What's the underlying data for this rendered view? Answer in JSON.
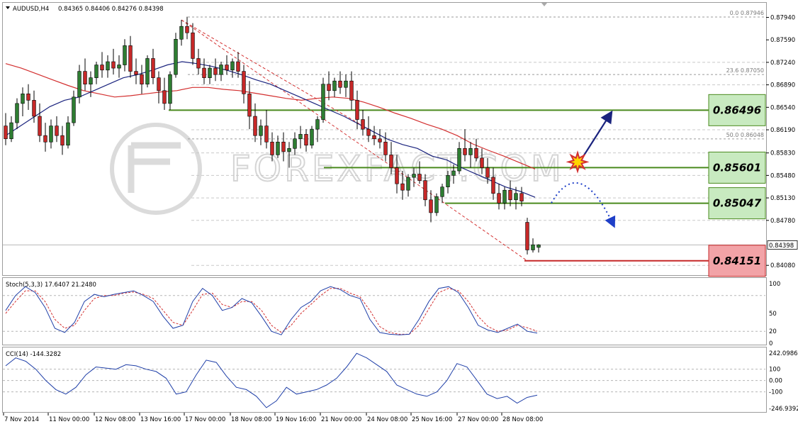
{
  "header": {
    "symbol": "AUDUSD,H4",
    "ohlc": "0.84365 0.84406 0.84276 0.84398"
  },
  "indicators": {
    "stoch_label": "Stoch(5,3,3) 17.6407 21.2480",
    "cci_label": "CCI(14) -144.3282"
  },
  "price_axis": {
    "ticks": [
      "0.87940",
      "0.87590",
      "0.87240",
      "0.86890",
      "0.86540",
      "0.86190",
      "0.85830",
      "0.85480",
      "0.85130",
      "0.84780",
      "0.84080"
    ],
    "current_price": "0.84398"
  },
  "stoch_axis": {
    "ticks": [
      "100",
      "50",
      "20",
      "0"
    ]
  },
  "cci_axis": {
    "ticks": [
      "242.0986",
      "100",
      "0.00",
      "-100",
      "-246.9392"
    ]
  },
  "time_axis": {
    "labels": [
      "7 Nov 2014",
      "11 Nov 00:00",
      "12 Nov 08:00",
      "13 Nov 16:00",
      "17 Nov 00:00",
      "18 Nov 08:00",
      "19 Nov 16:00",
      "21 Nov 00:00",
      "24 Nov 08:00",
      "25 Nov 16:00",
      "27 Nov 00:00",
      "28 Nov 08:00"
    ]
  },
  "fibonacci": {
    "levels": [
      {
        "label": "0.0  0.87946"
      },
      {
        "label": "23.6  0.87050"
      },
      {
        "label": "50.0  0.86048"
      }
    ]
  },
  "levels": [
    {
      "value": "0.86496",
      "color": "#c8eac0"
    },
    {
      "value": "0.85601",
      "color": "#c8eac0"
    },
    {
      "value": "0.85047",
      "color": "#c8eac0"
    },
    {
      "value": "0.84151",
      "color": "#f2a3a7"
    }
  ],
  "watermark": "FOREXFACT.COM",
  "colors": {
    "bull": "#2e7d32",
    "bear": "#c62828",
    "ma_fast": "#1a237e",
    "ma_slow": "#d32f2f",
    "support_line": "#4a8a1e",
    "red_line": "#c62828",
    "stoch": "#1f3fa8",
    "cci": "#1f3fa8"
  },
  "chart_data": {
    "type": "candlestick",
    "symbol": "AUDUSD",
    "timeframe": "H4",
    "ylim": [
      0.8395,
      0.881
    ],
    "highlighted_levels": [
      0.86496,
      0.85601,
      0.85047,
      0.84151
    ],
    "fibonacci": [
      {
        "ratio": 0.0,
        "price": 0.87946
      },
      {
        "ratio": 23.6,
        "price": 0.8705
      },
      {
        "ratio": 50.0,
        "price": 0.86048
      }
    ],
    "candles": [
      {
        "o": 0.8625,
        "h": 0.8645,
        "l": 0.8595,
        "c": 0.8605
      },
      {
        "o": 0.8605,
        "h": 0.864,
        "l": 0.86,
        "c": 0.863
      },
      {
        "o": 0.863,
        "h": 0.8668,
        "l": 0.862,
        "c": 0.866
      },
      {
        "o": 0.866,
        "h": 0.8685,
        "l": 0.864,
        "c": 0.8675
      },
      {
        "o": 0.8675,
        "h": 0.869,
        "l": 0.865,
        "c": 0.8665
      },
      {
        "o": 0.8665,
        "h": 0.868,
        "l": 0.863,
        "c": 0.864
      },
      {
        "o": 0.864,
        "h": 0.866,
        "l": 0.86,
        "c": 0.861
      },
      {
        "o": 0.861,
        "h": 0.863,
        "l": 0.8585,
        "c": 0.86
      },
      {
        "o": 0.86,
        "h": 0.8635,
        "l": 0.859,
        "c": 0.8625
      },
      {
        "o": 0.8625,
        "h": 0.864,
        "l": 0.86,
        "c": 0.861
      },
      {
        "o": 0.861,
        "h": 0.8625,
        "l": 0.858,
        "c": 0.8595
      },
      {
        "o": 0.8595,
        "h": 0.864,
        "l": 0.859,
        "c": 0.863
      },
      {
        "o": 0.863,
        "h": 0.868,
        "l": 0.8625,
        "c": 0.867
      },
      {
        "o": 0.867,
        "h": 0.872,
        "l": 0.866,
        "c": 0.871
      },
      {
        "o": 0.871,
        "h": 0.873,
        "l": 0.868,
        "c": 0.869
      },
      {
        "o": 0.869,
        "h": 0.871,
        "l": 0.867,
        "c": 0.87
      },
      {
        "o": 0.87,
        "h": 0.8725,
        "l": 0.869,
        "c": 0.872
      },
      {
        "o": 0.872,
        "h": 0.874,
        "l": 0.87,
        "c": 0.8712
      },
      {
        "o": 0.8712,
        "h": 0.8735,
        "l": 0.87,
        "c": 0.8725
      },
      {
        "o": 0.8725,
        "h": 0.8745,
        "l": 0.8705,
        "c": 0.8715
      },
      {
        "o": 0.8715,
        "h": 0.8735,
        "l": 0.87,
        "c": 0.872
      },
      {
        "o": 0.872,
        "h": 0.876,
        "l": 0.871,
        "c": 0.875
      },
      {
        "o": 0.875,
        "h": 0.8765,
        "l": 0.87,
        "c": 0.871
      },
      {
        "o": 0.871,
        "h": 0.873,
        "l": 0.869,
        "c": 0.8705
      },
      {
        "o": 0.8705,
        "h": 0.872,
        "l": 0.8675,
        "c": 0.869
      },
      {
        "o": 0.869,
        "h": 0.8735,
        "l": 0.8685,
        "c": 0.873
      },
      {
        "o": 0.873,
        "h": 0.8745,
        "l": 0.869,
        "c": 0.87
      },
      {
        "o": 0.87,
        "h": 0.871,
        "l": 0.866,
        "c": 0.868
      },
      {
        "o": 0.868,
        "h": 0.87,
        "l": 0.865,
        "c": 0.866
      },
      {
        "o": 0.866,
        "h": 0.871,
        "l": 0.865,
        "c": 0.8705
      },
      {
        "o": 0.8705,
        "h": 0.877,
        "l": 0.87,
        "c": 0.876
      },
      {
        "o": 0.876,
        "h": 0.879,
        "l": 0.875,
        "c": 0.878
      },
      {
        "o": 0.878,
        "h": 0.8795,
        "l": 0.876,
        "c": 0.877
      },
      {
        "o": 0.877,
        "h": 0.8785,
        "l": 0.872,
        "c": 0.873
      },
      {
        "o": 0.873,
        "h": 0.8745,
        "l": 0.8705,
        "c": 0.8715
      },
      {
        "o": 0.8715,
        "h": 0.873,
        "l": 0.869,
        "c": 0.87
      },
      {
        "o": 0.87,
        "h": 0.872,
        "l": 0.869,
        "c": 0.8715
      },
      {
        "o": 0.8715,
        "h": 0.873,
        "l": 0.8695,
        "c": 0.8705
      },
      {
        "o": 0.8705,
        "h": 0.8725,
        "l": 0.8695,
        "c": 0.872
      },
      {
        "o": 0.872,
        "h": 0.8735,
        "l": 0.8705,
        "c": 0.8712
      },
      {
        "o": 0.8712,
        "h": 0.873,
        "l": 0.87,
        "c": 0.8725
      },
      {
        "o": 0.8725,
        "h": 0.874,
        "l": 0.87,
        "c": 0.871
      },
      {
        "o": 0.871,
        "h": 0.872,
        "l": 0.866,
        "c": 0.8675
      },
      {
        "o": 0.8675,
        "h": 0.8695,
        "l": 0.862,
        "c": 0.864
      },
      {
        "o": 0.864,
        "h": 0.866,
        "l": 0.86,
        "c": 0.861
      },
      {
        "o": 0.861,
        "h": 0.8635,
        "l": 0.8595,
        "c": 0.8625
      },
      {
        "o": 0.8625,
        "h": 0.865,
        "l": 0.859,
        "c": 0.86
      },
      {
        "o": 0.86,
        "h": 0.8615,
        "l": 0.857,
        "c": 0.858
      },
      {
        "o": 0.858,
        "h": 0.861,
        "l": 0.8575,
        "c": 0.86
      },
      {
        "o": 0.86,
        "h": 0.8615,
        "l": 0.857,
        "c": 0.8585
      },
      {
        "o": 0.8585,
        "h": 0.86,
        "l": 0.856,
        "c": 0.859
      },
      {
        "o": 0.859,
        "h": 0.8615,
        "l": 0.858,
        "c": 0.8605
      },
      {
        "o": 0.8605,
        "h": 0.8625,
        "l": 0.859,
        "c": 0.8612
      },
      {
        "o": 0.8612,
        "h": 0.862,
        "l": 0.8585,
        "c": 0.8595
      },
      {
        "o": 0.8595,
        "h": 0.8625,
        "l": 0.859,
        "c": 0.862
      },
      {
        "o": 0.862,
        "h": 0.864,
        "l": 0.86,
        "c": 0.8635
      },
      {
        "o": 0.8635,
        "h": 0.87,
        "l": 0.863,
        "c": 0.869
      },
      {
        "o": 0.869,
        "h": 0.871,
        "l": 0.8665,
        "c": 0.868
      },
      {
        "o": 0.868,
        "h": 0.87,
        "l": 0.867,
        "c": 0.8695
      },
      {
        "o": 0.8695,
        "h": 0.871,
        "l": 0.8675,
        "c": 0.8685
      },
      {
        "o": 0.8685,
        "h": 0.8705,
        "l": 0.867,
        "c": 0.8695
      },
      {
        "o": 0.8695,
        "h": 0.871,
        "l": 0.865,
        "c": 0.8665
      },
      {
        "o": 0.8665,
        "h": 0.868,
        "l": 0.862,
        "c": 0.8635
      },
      {
        "o": 0.8635,
        "h": 0.865,
        "l": 0.861,
        "c": 0.862
      },
      {
        "o": 0.862,
        "h": 0.864,
        "l": 0.86,
        "c": 0.861
      },
      {
        "o": 0.861,
        "h": 0.8625,
        "l": 0.8595,
        "c": 0.8605
      },
      {
        "o": 0.8605,
        "h": 0.862,
        "l": 0.859,
        "c": 0.86
      },
      {
        "o": 0.86,
        "h": 0.8615,
        "l": 0.857,
        "c": 0.858
      },
      {
        "o": 0.858,
        "h": 0.86,
        "l": 0.855,
        "c": 0.856
      },
      {
        "o": 0.856,
        "h": 0.858,
        "l": 0.852,
        "c": 0.8535
      },
      {
        "o": 0.8535,
        "h": 0.8555,
        "l": 0.851,
        "c": 0.8525
      },
      {
        "o": 0.8525,
        "h": 0.855,
        "l": 0.8515,
        "c": 0.8545
      },
      {
        "o": 0.8545,
        "h": 0.856,
        "l": 0.853,
        "c": 0.855
      },
      {
        "o": 0.855,
        "h": 0.857,
        "l": 0.8535,
        "c": 0.854
      },
      {
        "o": 0.854,
        "h": 0.855,
        "l": 0.85,
        "c": 0.851
      },
      {
        "o": 0.851,
        "h": 0.8525,
        "l": 0.8475,
        "c": 0.849
      },
      {
        "o": 0.849,
        "h": 0.852,
        "l": 0.8485,
        "c": 0.8515
      },
      {
        "o": 0.8515,
        "h": 0.8535,
        "l": 0.8505,
        "c": 0.853
      },
      {
        "o": 0.853,
        "h": 0.8555,
        "l": 0.852,
        "c": 0.8548
      },
      {
        "o": 0.8548,
        "h": 0.8565,
        "l": 0.8535,
        "c": 0.8555
      },
      {
        "o": 0.8555,
        "h": 0.86,
        "l": 0.855,
        "c": 0.859
      },
      {
        "o": 0.859,
        "h": 0.862,
        "l": 0.857,
        "c": 0.858
      },
      {
        "o": 0.858,
        "h": 0.86,
        "l": 0.856,
        "c": 0.859
      },
      {
        "o": 0.859,
        "h": 0.8605,
        "l": 0.857,
        "c": 0.8575
      },
      {
        "o": 0.8575,
        "h": 0.859,
        "l": 0.855,
        "c": 0.856
      },
      {
        "o": 0.856,
        "h": 0.8575,
        "l": 0.8535,
        "c": 0.8545
      },
      {
        "o": 0.8545,
        "h": 0.856,
        "l": 0.851,
        "c": 0.852
      },
      {
        "o": 0.852,
        "h": 0.8535,
        "l": 0.8495,
        "c": 0.8505
      },
      {
        "o": 0.8505,
        "h": 0.853,
        "l": 0.8495,
        "c": 0.8525
      },
      {
        "o": 0.8525,
        "h": 0.854,
        "l": 0.85,
        "c": 0.851
      },
      {
        "o": 0.851,
        "h": 0.853,
        "l": 0.8495,
        "c": 0.852
      },
      {
        "o": 0.852,
        "h": 0.853,
        "l": 0.85,
        "c": 0.8508
      },
      {
        "o": 0.8475,
        "h": 0.8482,
        "l": 0.8425,
        "c": 0.8432
      },
      {
        "o": 0.8432,
        "h": 0.845,
        "l": 0.8428,
        "c": 0.844
      },
      {
        "o": 0.8436,
        "h": 0.8441,
        "l": 0.8428,
        "c": 0.844
      }
    ],
    "ma_fast": [
      0.861,
      0.8625,
      0.864,
      0.8655,
      0.8665,
      0.867,
      0.868,
      0.869,
      0.87,
      0.8705,
      0.8712,
      0.872,
      0.8725,
      0.8722,
      0.8718,
      0.8712,
      0.8705,
      0.8697,
      0.869,
      0.868,
      0.867,
      0.866,
      0.865,
      0.864,
      0.8628,
      0.8616,
      0.8604,
      0.8596,
      0.859,
      0.8578,
      0.8572,
      0.856,
      0.855,
      0.854,
      0.853,
      0.8523,
      0.8514
    ],
    "ma_slow": [
      0.8722,
      0.8715,
      0.8706,
      0.8697,
      0.8688,
      0.868,
      0.8675,
      0.867,
      0.8672,
      0.8675,
      0.8678,
      0.868,
      0.8685,
      0.8685,
      0.8682,
      0.868,
      0.8676,
      0.8672,
      0.8668,
      0.8665,
      0.8668,
      0.867,
      0.8668,
      0.8662,
      0.8654,
      0.8645,
      0.8637,
      0.8628,
      0.862,
      0.861,
      0.8597,
      0.8587,
      0.8578,
      0.8568,
      0.8558
    ],
    "stoch": {
      "ylim": [
        0,
        100
      ],
      "k": [
        55,
        80,
        95,
        85,
        60,
        25,
        18,
        35,
        70,
        82,
        78,
        82,
        85,
        88,
        80,
        70,
        45,
        25,
        30,
        70,
        92,
        80,
        55,
        60,
        75,
        68,
        45,
        20,
        14,
        40,
        60,
        70,
        88,
        95,
        90,
        80,
        75,
        40,
        18,
        15,
        14,
        15,
        40,
        70,
        92,
        95,
        85,
        60,
        30,
        22,
        18,
        25,
        32,
        20,
        17
      ],
      "d": [
        50,
        70,
        88,
        88,
        70,
        40,
        25,
        30,
        55,
        75,
        80,
        80,
        84,
        86,
        82,
        75,
        55,
        35,
        30,
        55,
        82,
        84,
        65,
        60,
        70,
        70,
        55,
        30,
        18,
        30,
        50,
        65,
        80,
        92,
        92,
        84,
        78,
        55,
        28,
        18,
        15,
        15,
        30,
        58,
        85,
        92,
        88,
        70,
        45,
        28,
        20,
        22,
        30,
        26,
        20
      ],
      "levels": [
        80,
        20
      ]
    },
    "cci": {
      "ylim": [
        -246.9392,
        242.0986
      ],
      "values": [
        130,
        200,
        170,
        100,
        0,
        -80,
        -120,
        -60,
        50,
        120,
        110,
        100,
        140,
        130,
        100,
        80,
        20,
        -120,
        -100,
        50,
        180,
        160,
        40,
        -60,
        -80,
        -140,
        -240,
        -180,
        -60,
        -120,
        -100,
        -80,
        -40,
        20,
        120,
        240,
        200,
        140,
        80,
        -40,
        -80,
        -120,
        -140,
        -100,
        0,
        150,
        120,
        0,
        -120,
        -160,
        -140,
        -200,
        -150,
        -130
      ],
      "levels": [
        100,
        -100
      ]
    }
  }
}
